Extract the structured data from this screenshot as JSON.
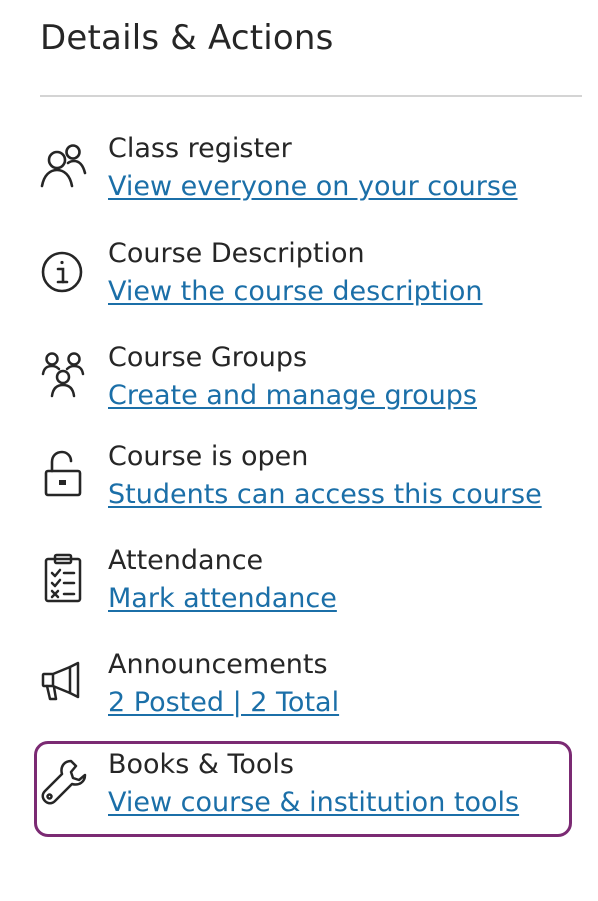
{
  "panel": {
    "title": "Details & Actions"
  },
  "items": [
    {
      "title": "Class register",
      "link": "View everyone on your course",
      "icon": "people-icon"
    },
    {
      "title": "Course Description",
      "link": "View the course description",
      "icon": "info-icon"
    },
    {
      "title": "Course Groups",
      "link": "Create and manage groups",
      "icon": "groups-icon"
    },
    {
      "title": "Course is open",
      "link": "Students can access this course",
      "icon": "unlock-icon"
    },
    {
      "title": "Attendance",
      "link": "Mark attendance",
      "icon": "clipboard-icon"
    },
    {
      "title": "Announcements",
      "link": "2 Posted | 2 Total",
      "icon": "megaphone-icon"
    },
    {
      "title": "Books & Tools",
      "link": "View course & institution tools",
      "icon": "wrench-icon"
    }
  ],
  "colors": {
    "text": "#262626",
    "link": "#1b6fa8",
    "highlight_border": "#7b2a73",
    "divider": "#d4d4d4"
  }
}
